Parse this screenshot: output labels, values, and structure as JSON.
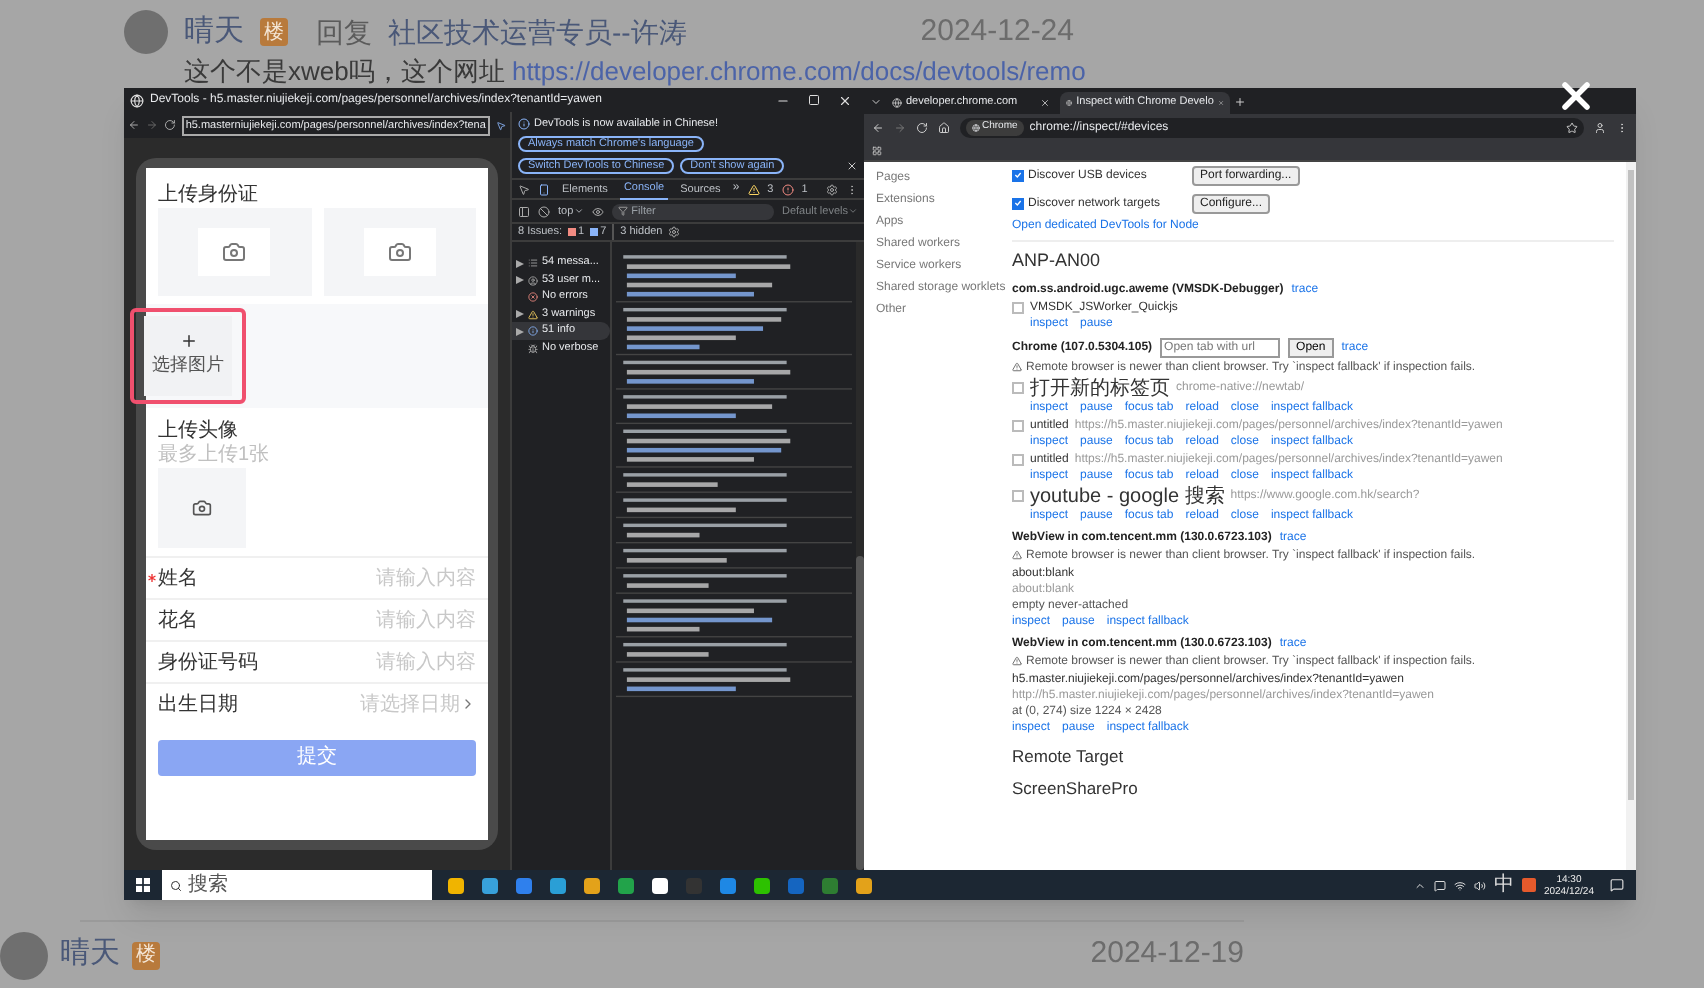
{
  "post": {
    "author": "晴天",
    "badge": "楼",
    "reply_label": "回复",
    "reply_to": "社区技术运营专员--许涛",
    "date": "2024-12-24",
    "text": "这个不是xweb吗，这个网址 ",
    "link": "https://developer.chrome.com/docs/devtools/remo"
  },
  "screenshot": {
    "devtools": {
      "title": "DevTools - h5.master.niujiekeji.com/pages/personnel/archives/index?tenantId=yawen",
      "url": "h5.masterniujiekeji.com/pages/personnel/archives/index?tena",
      "phone": {
        "id_section": "上传身份证",
        "pick_image": "选择图片",
        "avatar_section": "上传头像",
        "avatar_hint": "最多上传1张",
        "submit": "提交",
        "fields": [
          {
            "label": "姓名",
            "required": true,
            "placeholder": "请输入内容",
            "kind": "input"
          },
          {
            "label": "花名",
            "required": false,
            "placeholder": "请输入内容",
            "kind": "input"
          },
          {
            "label": "身份证号码",
            "required": false,
            "placeholder": "请输入内容",
            "kind": "input"
          },
          {
            "label": "出生日期",
            "required": false,
            "placeholder": "请选择日期",
            "kind": "picker"
          }
        ]
      },
      "notice": {
        "text": "DevTools is now available in Chinese!",
        "buttons": [
          "Always match Chrome's language",
          "Switch DevTools to Chinese",
          "Don't show again"
        ]
      },
      "panel_tabs": [
        {
          "label": "Elements",
          "selected": false
        },
        {
          "label": "Console",
          "selected": true
        },
        {
          "label": "Sources",
          "selected": false
        }
      ],
      "more": "»",
      "warnings": "3",
      "errors": "1",
      "context": "top",
      "filter_placeholder": "Filter",
      "levels": "Default levels",
      "issues": {
        "label": "8 Issues:",
        "errors": "1",
        "infos": "7",
        "hidden": "3 hidden"
      },
      "sidebar": [
        {
          "label": "54 messa...",
          "kind": "messages",
          "has_children": true,
          "selected": false
        },
        {
          "label": "53 user m...",
          "kind": "user",
          "has_children": true,
          "selected": false
        },
        {
          "label": "No errors",
          "kind": "errors",
          "has_children": false,
          "selected": false
        },
        {
          "label": "3 warnings",
          "kind": "warnings",
          "has_children": true,
          "selected": false
        },
        {
          "label": "51 info",
          "kind": "info",
          "has_children": true,
          "selected": true
        },
        {
          "label": "No verbose",
          "kind": "verbose",
          "has_children": false,
          "selected": false
        }
      ]
    },
    "browser": {
      "tabs": [
        {
          "title": "developer.chrome.com",
          "selected": false
        },
        {
          "title": "Inspect with Chrome Develo",
          "selected": true
        }
      ],
      "chip": "Chrome",
      "url": "chrome://inspect/#devices",
      "sidebar": [
        "Pages",
        "Extensions",
        "Apps",
        "Shared workers",
        "Service workers",
        "Shared storage worklets",
        "Other"
      ],
      "options": [
        {
          "label": "Discover USB devices",
          "checked": true,
          "button": "Port forwarding..."
        },
        {
          "label": "Discover network targets",
          "checked": true,
          "button": "Configure..."
        }
      ],
      "node_link": "Open dedicated DevTools for Node",
      "device": "ANP-AN00",
      "apps": [
        {
          "title": "com.ss.android.ugc.aweme (VMSDK-Debugger)",
          "trace": "trace",
          "targets": [
            {
              "name": "VMSDK_JSWorker_Quickjs",
              "checked": false,
              "actions": [
                "inspect",
                "pause"
              ]
            }
          ]
        },
        {
          "title": "Chrome (107.0.5304.105)",
          "open_placeholder": "Open tab with url",
          "open_button": "Open",
          "trace": "trace",
          "warning": "Remote browser is newer than client browser. Try `inspect fallback' if inspection fails.",
          "targets": [
            {
              "name": "打开新的标签页",
              "url": "chrome-native://newtab/",
              "checked": false,
              "actions": [
                "inspect",
                "pause",
                "focus tab",
                "reload",
                "close",
                "inspect fallback"
              ]
            },
            {
              "name": "untitled",
              "url": "https://h5.master.niujiekeji.com/pages/personnel/archives/index?tenantId=yawen",
              "checked": false,
              "actions": [
                "inspect",
                "pause",
                "focus tab",
                "reload",
                "close",
                "inspect fallback"
              ]
            },
            {
              "name": "untitled",
              "url": "https://h5.master.niujiekeji.com/pages/personnel/archives/index?tenantId=yawen",
              "checked": false,
              "actions": [
                "inspect",
                "pause",
                "focus tab",
                "reload",
                "close",
                "inspect fallback"
              ]
            },
            {
              "name": "youtube - google 搜索",
              "url": "https://www.google.com.hk/search?",
              "checked": false,
              "actions": [
                "inspect",
                "pause",
                "focus tab",
                "reload",
                "close",
                "inspect fallback"
              ]
            }
          ]
        },
        {
          "title": "WebView in com.tencent.mm (130.0.6723.103)",
          "trace": "trace",
          "warning": "Remote browser is newer than client browser. Try `inspect fallback' if inspection fails.",
          "targets": [
            {
              "name": "about:blank",
              "url": "about:blank",
              "detail": "empty never-attached",
              "actions": [
                "inspect",
                "pause",
                "inspect fallback"
              ]
            }
          ]
        },
        {
          "title": "WebView in com.tencent.mm (130.0.6723.103)",
          "trace": "trace",
          "warning": "Remote browser is newer than client browser. Try `inspect fallback' if inspection fails.",
          "targets": [
            {
              "name": "h5.master.niujiekeji.com/pages/personnel/archives/index?tenantId=yawen",
              "url": "http://h5.master.niujiekeji.com/pages/personnel/archives/index?tenantId=yawen",
              "detail": "at (0, 274)  size 1224 × 2428",
              "actions": [
                "inspect",
                "pause",
                "inspect fallback"
              ]
            }
          ]
        }
      ],
      "remote_targets": [
        "Remote Target",
        "ScreenSharePro"
      ]
    },
    "taskbar": {
      "search": "搜索",
      "ime": "中",
      "time": "14:30",
      "date": "2024/12/24"
    }
  },
  "next_post": {
    "author": "晴天",
    "badge": "楼",
    "date": "2024-12-19"
  }
}
